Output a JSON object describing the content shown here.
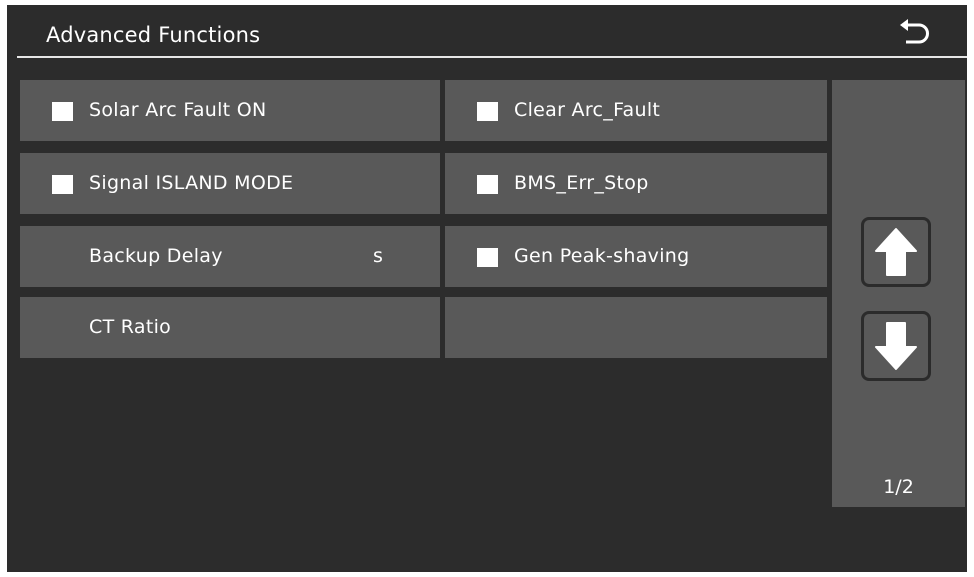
{
  "header": {
    "title": "Advanced Functions",
    "back_icon": "return-arrow-icon"
  },
  "settings": {
    "solar_arc_fault": {
      "label": "Solar Arc Fault ON",
      "checked": false
    },
    "clear_arc_fault": {
      "label": "Clear Arc_Fault",
      "checked": false
    },
    "signal_island_mode": {
      "label": "Signal ISLAND MODE",
      "checked": false
    },
    "bms_err_stop": {
      "label": "BMS_Err_Stop",
      "checked": false
    },
    "backup_delay": {
      "label": "Backup Delay",
      "unit": "s",
      "value": ""
    },
    "gen_peak_shaving": {
      "label": "Gen Peak-shaving",
      "checked": false
    },
    "ct_ratio": {
      "label": "CT Ratio",
      "value": ""
    }
  },
  "pager": {
    "up_icon": "arrow-up-icon",
    "down_icon": "arrow-down-icon",
    "indicator": "1/2"
  },
  "colors": {
    "background": "#2c2c2c",
    "cell": "#595959",
    "text": "#ffffff",
    "checkbox": "#ffffff"
  }
}
